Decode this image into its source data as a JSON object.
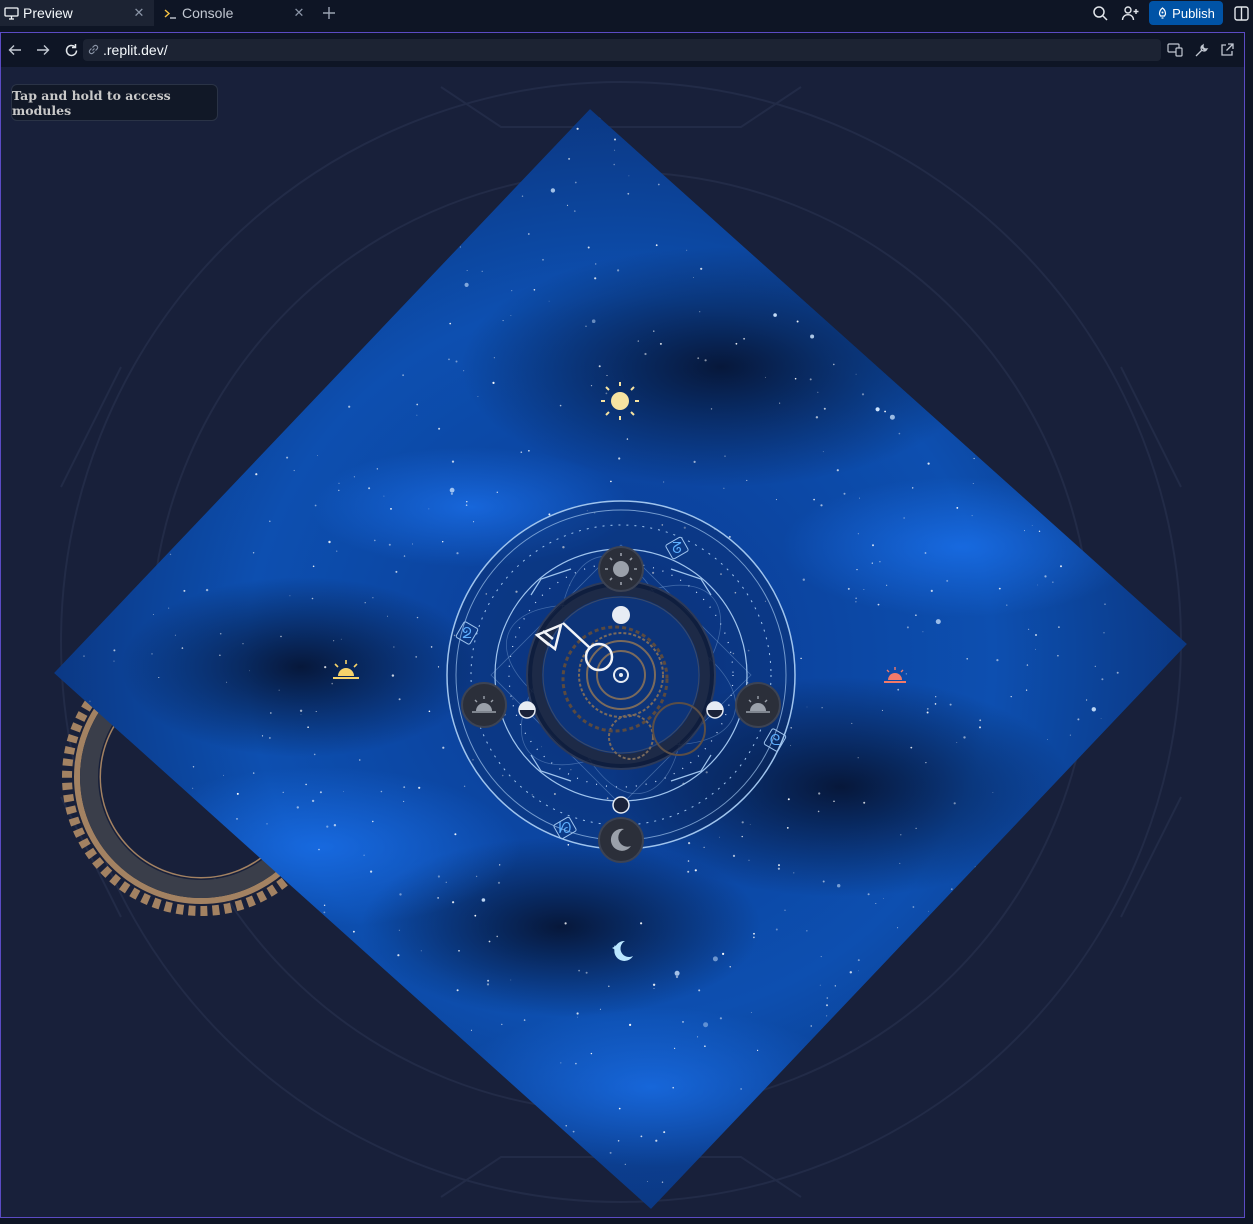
{
  "tabs": [
    {
      "label": "Preview",
      "icon": "monitor-icon",
      "active": true
    },
    {
      "label": "Console",
      "icon": "terminal-icon",
      "active": false
    }
  ],
  "toolbar": {
    "publish_label": "Publish",
    "accent": "#0053a6",
    "frame_border": "#5b4bc4"
  },
  "browser": {
    "url": ".replit.dev/"
  },
  "app": {
    "hint": "Tap and hold to access modules",
    "background": "#18203a",
    "sky_colors": [
      "#0a3a8c",
      "#0b1b3f"
    ],
    "celestial_markers": [
      {
        "name": "noon-sun-icon",
        "color": "#f6e3a1"
      },
      {
        "name": "sunrise-icon",
        "color": "#f6d36a"
      },
      {
        "name": "sunset-icon",
        "color": "#f07a6a"
      },
      {
        "name": "midnight-moon-icon",
        "color": "#b9e6ff"
      }
    ],
    "dial_glyphs": [
      "ᘔ",
      "ᘖ",
      "ᘓ",
      "ᘗ"
    ]
  }
}
